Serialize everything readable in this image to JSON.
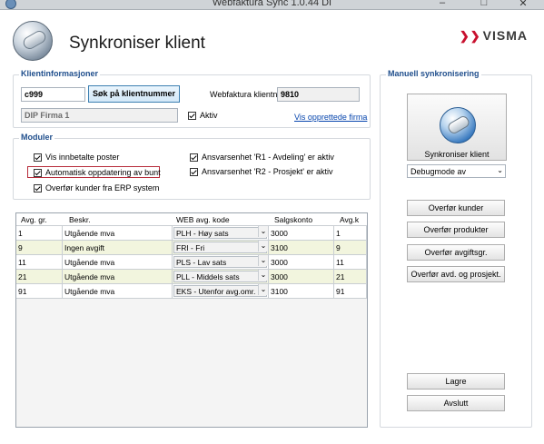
{
  "window": {
    "title": "Webfaktura Sync 1.0.44 DI"
  },
  "header": {
    "title": "Synkroniser klient",
    "brand": "VISMA",
    "brand_color": "#c8102e"
  },
  "client_info": {
    "title": "Klientinformasjoner",
    "client_number": "c999",
    "search_button": "Søk på klientnummer",
    "webfaktura_label": "Webfaktura klientnr.",
    "webfaktura_value": "9810",
    "firm_name": "DIP Firma 1",
    "active_label": "Aktiv",
    "active_checked": true,
    "firms_link": "Vis opprettede firma"
  },
  "modules": {
    "title": "Moduler",
    "items": [
      {
        "label": "Vis innbetalte poster",
        "checked": true
      },
      {
        "label": "Automatisk oppdatering av bunt",
        "checked": true
      },
      {
        "label": "Overfør kunder fra ERP system",
        "checked": true
      },
      {
        "label": "Ansvarsenhet 'R1 - Avdeling' er aktiv",
        "checked": true
      },
      {
        "label": "Ansvarsenhet 'R2 - Prosjekt' er aktiv",
        "checked": true
      }
    ]
  },
  "table": {
    "columns": [
      "Avg. gr.",
      "Beskr.",
      "WEB avg. kode",
      "Salgskonto",
      "Avg.k"
    ],
    "rows": [
      {
        "group": "1",
        "desc": "Utgående mva",
        "code": "PLH - Høy sats",
        "account": "3000",
        "avgk": "1"
      },
      {
        "group": "9",
        "desc": "Ingen avgift",
        "code": "FRI - Fri",
        "account": "3100",
        "avgk": "9"
      },
      {
        "group": "11",
        "desc": "Utgående mva",
        "code": "PLS - Lav sats",
        "account": "3000",
        "avgk": "11"
      },
      {
        "group": "21",
        "desc": "Utgående mva",
        "code": "PLL - Middels sats",
        "account": "3000",
        "avgk": "21"
      },
      {
        "group": "91",
        "desc": "Utgående mva",
        "code": "EKS - Utenfor avg.omr.",
        "account": "3100",
        "avgk": "91"
      }
    ]
  },
  "manual_sync": {
    "title": "Manuell synkronisering",
    "sync_button": "Synkroniser klient",
    "debug_select": "Debugmode av",
    "buttons": [
      "Overfør kunder",
      "Overfør produkter",
      "Overfør avgiftsgr.",
      "Overfør avd. og prosjekt."
    ],
    "save": "Lagre",
    "exit": "Avslutt"
  }
}
